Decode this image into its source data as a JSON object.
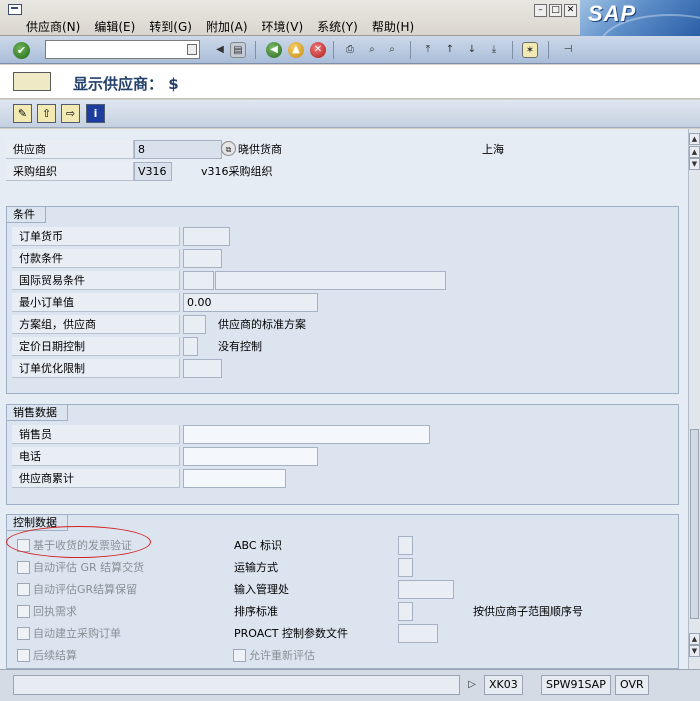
{
  "menu": {
    "items": [
      "供应商(N)",
      "编辑(E)",
      "转到(G)",
      "附加(A)",
      "环境(V)",
      "系统(Y)",
      "帮助(H)"
    ],
    "logo": "SAP"
  },
  "toolbar": {
    "command_value": "",
    "icons": [
      "enter-icon",
      "back-icon",
      "save-icon",
      "exit-icon",
      "cancel-icon",
      "print-icon",
      "find-icon",
      "find-next-icon",
      "first-page-icon",
      "prev-page-icon",
      "next-page-icon",
      "last-page-icon",
      "new-session-icon",
      "shortcut-icon"
    ]
  },
  "title": "显示供应商： $",
  "vendor_header": {
    "vendor_label": "供应商",
    "vendor_value": "8",
    "vendor_name": "晓供货商",
    "vendor_city": "上海",
    "porg_label": "采购组织",
    "porg_value": "V316",
    "porg_name": "v316采购组织"
  },
  "conditions": {
    "title": "条件",
    "rows": [
      {
        "label": "订单货币",
        "value": "",
        "desc": ""
      },
      {
        "label": "付款条件",
        "value": "",
        "desc": ""
      },
      {
        "label": "国际贸易条件",
        "value": "",
        "value2": "",
        "desc": ""
      },
      {
        "label": "最小订单值",
        "value": "0.00",
        "desc": ""
      },
      {
        "label": "方案组，供应商",
        "value": "",
        "desc": "供应商的标准方案"
      },
      {
        "label": "定价日期控制",
        "value": "",
        "desc": "没有控制"
      },
      {
        "label": "订单优化限制",
        "value": "",
        "desc": ""
      }
    ]
  },
  "sales": {
    "title": "销售数据",
    "rows": [
      {
        "label": "销售员",
        "value": ""
      },
      {
        "label": "电话",
        "value": ""
      },
      {
        "label": "供应商累计",
        "value": ""
      }
    ]
  },
  "control": {
    "title": "控制数据",
    "checkboxes": [
      {
        "label": "基于收货的发票验证",
        "checked": false
      },
      {
        "label": "自动评估 GR 结算交货",
        "checked": false
      },
      {
        "label": "自动评估GR结算保留",
        "checked": false
      },
      {
        "label": "回执需求",
        "checked": false
      },
      {
        "label": "自动建立采购订单",
        "checked": false
      },
      {
        "label": "后续结算",
        "checked": false
      }
    ],
    "fields": [
      {
        "label": "ABC 标识",
        "value": ""
      },
      {
        "label": "运输方式",
        "value": ""
      },
      {
        "label": "输入管理处",
        "value": ""
      },
      {
        "label": "排序标准",
        "value": "",
        "desc": "按供应商子范围顺序号"
      },
      {
        "label": "PROACT 控制参数文件",
        "value": ""
      }
    ],
    "revaluation_label": "允许重新评估",
    "revaluation_checked": false
  },
  "status": {
    "transaction": "XK03",
    "system": "SPW91SAP",
    "mode": "OVR"
  },
  "colors": {
    "accent": "#23406b",
    "highlight": "#d42020"
  }
}
